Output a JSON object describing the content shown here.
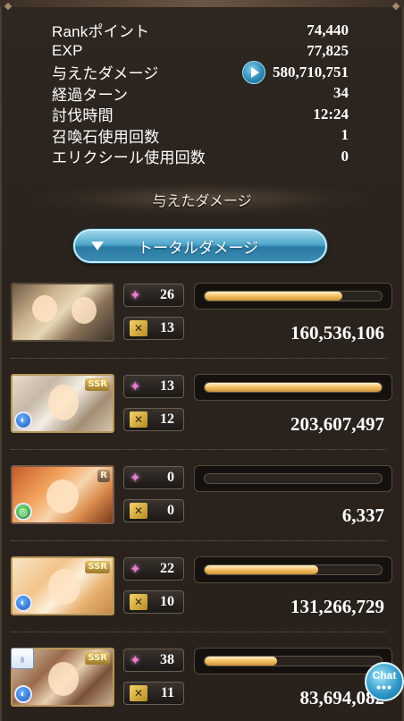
{
  "stats": [
    {
      "label": "Rankポイント",
      "value": "74,440"
    },
    {
      "label": "EXP",
      "value": "77,825"
    },
    {
      "label": "与えたダメージ",
      "value": "580,710,751",
      "has_play_button": true
    },
    {
      "label": "経過ターン",
      "value": "34"
    },
    {
      "label": "討伐時間",
      "value": "12:24"
    },
    {
      "label": "召喚石使用回数",
      "value": "1"
    },
    {
      "label": "エリクシール使用回数",
      "value": "0"
    }
  ],
  "section_title": "与えたダメージ",
  "total_button": {
    "label": "トータルダメージ"
  },
  "characters": [
    {
      "rarity": "",
      "element": "",
      "ability_count": "26",
      "ougi_count": "13",
      "damage": "160,536,106",
      "bar_fraction": 0.78
    },
    {
      "rarity": "SSR",
      "element": "water",
      "ability_count": "13",
      "ougi_count": "12",
      "damage": "203,607,497",
      "bar_fraction": 1.0
    },
    {
      "rarity": "R",
      "element": "wind",
      "ability_count": "0",
      "ougi_count": "0",
      "damage": "6,337",
      "bar_fraction": 0.0
    },
    {
      "rarity": "SSR",
      "element": "water",
      "ability_count": "22",
      "ougi_count": "10",
      "damage": "131,266,729",
      "bar_fraction": 0.64
    },
    {
      "rarity": "SSR",
      "element": "water",
      "ability_count": "38",
      "ougi_count": "11",
      "damage": "83,694,082",
      "bar_fraction": 0.41
    }
  ],
  "chat": {
    "label": "Chat",
    "dots": "•••"
  },
  "colors": {
    "bar_fill": "#f6c56a",
    "accent_blue": "#4ea6cb",
    "ability_pink": "#f07ad6"
  },
  "icons": [
    "play-icon",
    "chevron-down-icon",
    "ability-icon",
    "ougi-icon",
    "water-element-icon",
    "wind-element-icon",
    "chat-icon",
    "skill-icon"
  ]
}
